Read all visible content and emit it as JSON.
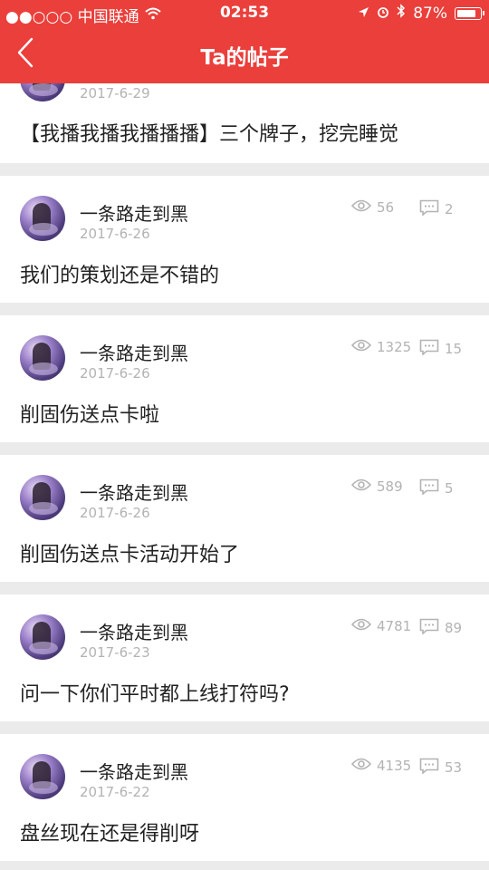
{
  "status_bar": {
    "carrier": "●●○○○ 中国联通",
    "time": "02:53",
    "battery": "87%"
  },
  "header": {
    "title": "Ta的帖子"
  },
  "posts": [
    {
      "username": "",
      "date": "2017-6-29",
      "views": "",
      "comments": "",
      "content": "【我播我播我播播播】三个牌子，挖完睡觉"
    },
    {
      "username": "一条路走到黑",
      "date": "2017-6-26",
      "views": "56",
      "comments": "2",
      "content": "我们的策划还是不错的"
    },
    {
      "username": "一条路走到黑",
      "date": "2017-6-26",
      "views": "1325",
      "comments": "15",
      "content": "削固伤送点卡啦"
    },
    {
      "username": "一条路走到黑",
      "date": "2017-6-26",
      "views": "589",
      "comments": "5",
      "content": "削固伤送点卡活动开始了"
    },
    {
      "username": "一条路走到黑",
      "date": "2017-6-23",
      "views": "4781",
      "comments": "89",
      "content": "问一下你们平时都上线打符吗?"
    },
    {
      "username": "一条路走到黑",
      "date": "2017-6-22",
      "views": "4135",
      "comments": "53",
      "content": "盘丝现在还是得削呀"
    }
  ],
  "icons": {
    "back": "chevron-left-icon",
    "views": "eye-icon",
    "comments": "comment-icon"
  },
  "colors": {
    "accent": "#ea3f3b",
    "meta_text": "#b3b3b3",
    "background": "#ebebeb"
  }
}
